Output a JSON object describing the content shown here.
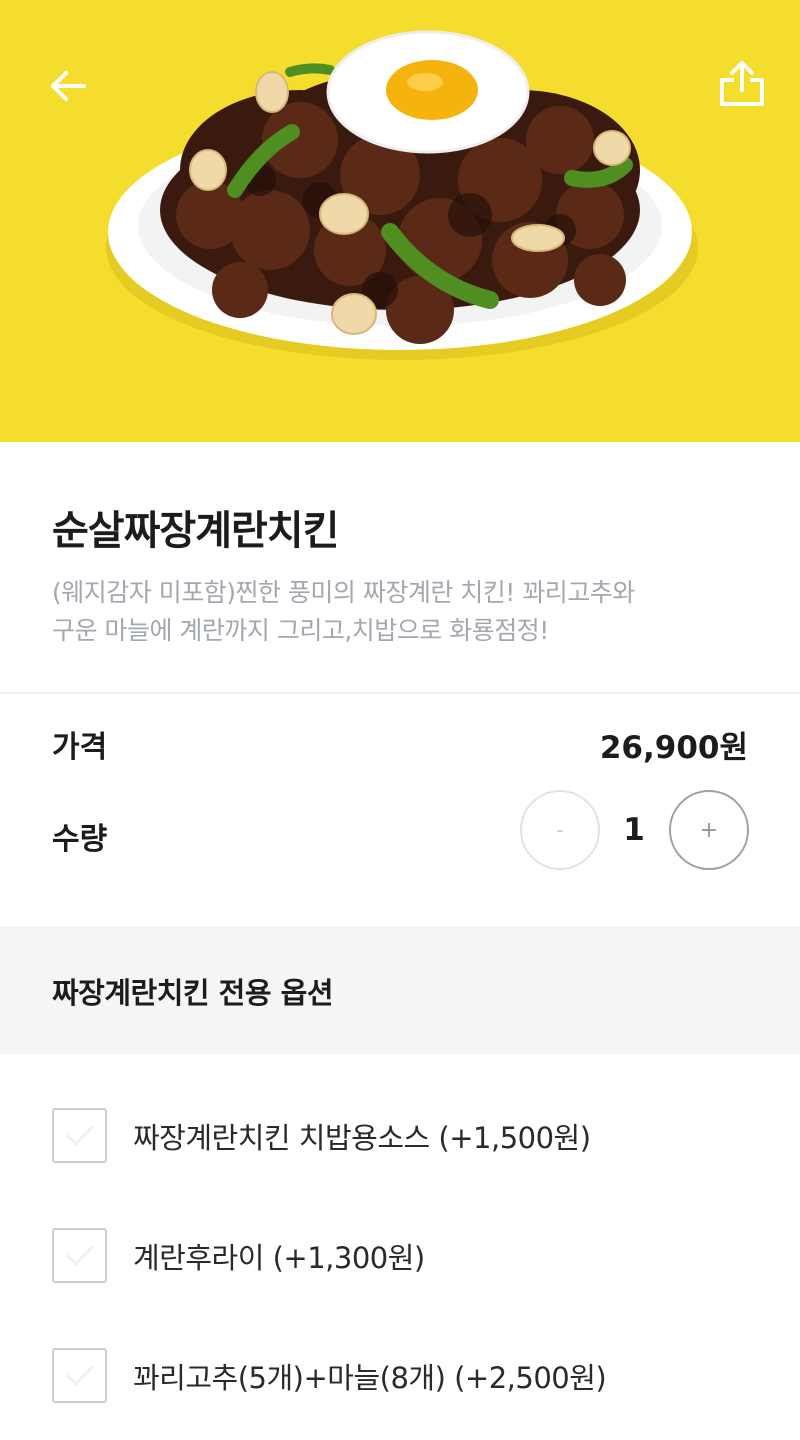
{
  "header": {
    "back_icon": "arrow-left-icon",
    "share_icon": "share-icon",
    "hero_bg_color": "#f5dd2e"
  },
  "product": {
    "name": "순살짜장계란치킨",
    "description_line1": "(웨지감자 미포함)찐한 풍미의 짜장계란 치킨! 꽈리고추와",
    "description_line2": "구운 마늘에 계란까지 그리고,치밥으로 화룡점정!"
  },
  "price": {
    "label": "가격",
    "value": "26,900원"
  },
  "quantity": {
    "label": "수량",
    "value": "1",
    "minus_label": "-",
    "plus_label": "+"
  },
  "options": {
    "section_title": "짜장계란치킨 전용 옵션",
    "items": [
      {
        "label": "짜장계란치킨 치밥용소스 (+1,500원)",
        "checked": false
      },
      {
        "label": "계란후라이 (+1,300원)",
        "checked": false
      },
      {
        "label": "꽈리고추(5개)+마늘(8개) (+2,500원)",
        "checked": false
      }
    ]
  }
}
